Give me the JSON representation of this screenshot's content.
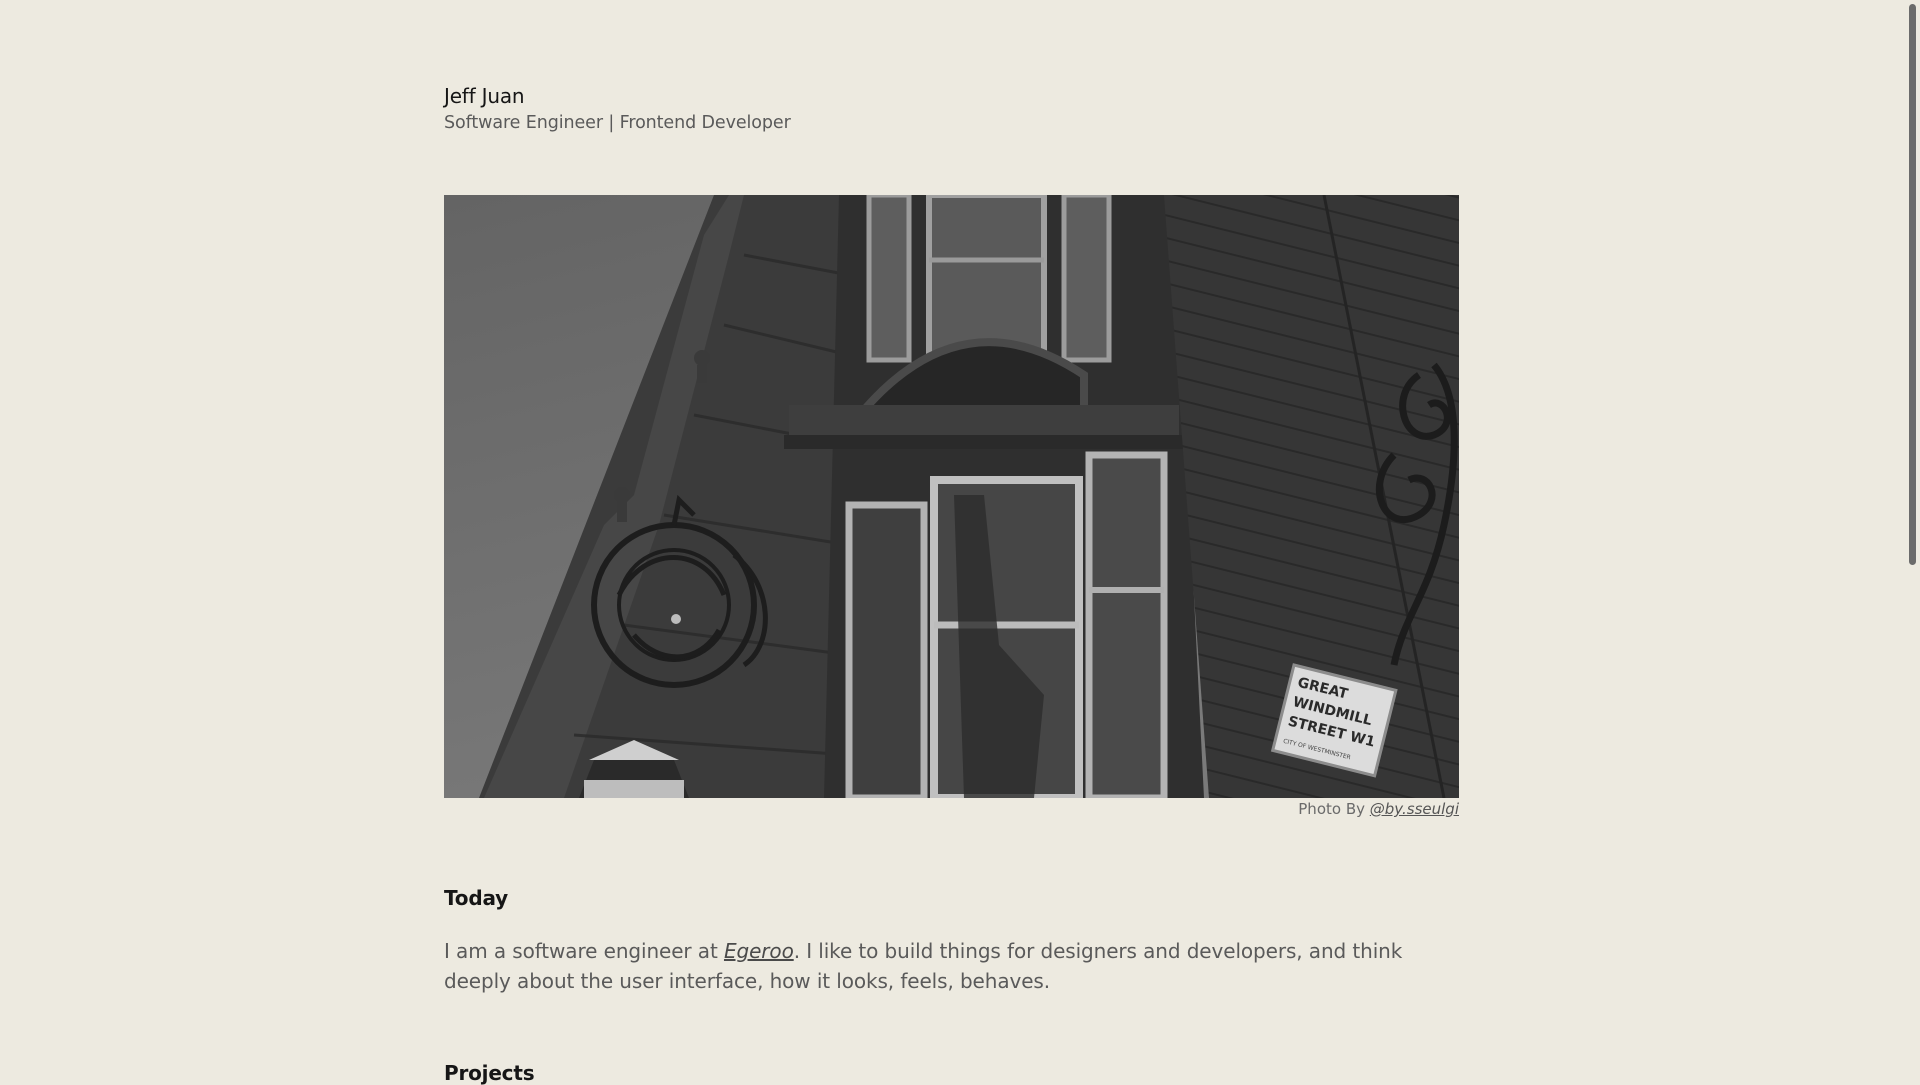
{
  "header": {
    "name": "Jeff Juan",
    "role": "Software Engineer | Frontend Developer"
  },
  "hero": {
    "alt": "Black and white photo of a corner building with an ornate iron sign and a Great Windmill Street sign",
    "sign_lines": [
      "GREAT",
      "WINDMILL",
      "STREET W1"
    ],
    "sign_subtext": "CITY OF WESTMINSTER"
  },
  "caption": {
    "prefix": "Photo By ",
    "link_text": "@by.sseulgi"
  },
  "today": {
    "title": "Today",
    "intro_before": "I am a software engineer at ",
    "company": "Egeroo",
    "intro_after": ". I like to build things for designers and developers, and think deeply about the user interface, how it looks, feels, behaves."
  },
  "projects": {
    "title": "Projects"
  }
}
